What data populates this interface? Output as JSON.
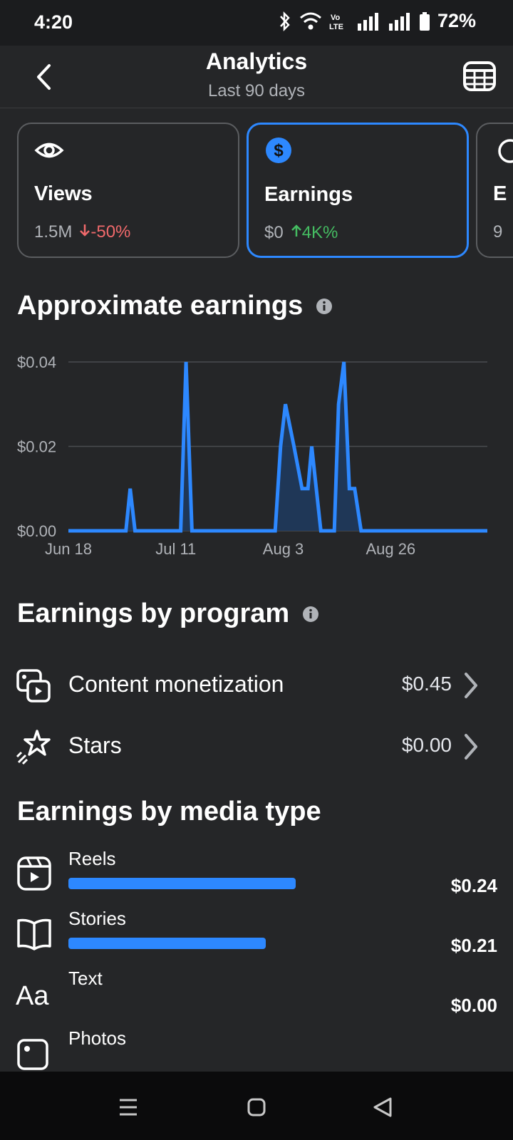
{
  "status_bar": {
    "time": "4:20",
    "battery": "72%"
  },
  "header": {
    "title": "Analytics",
    "subtitle": "Last 90 days"
  },
  "cards": [
    {
      "label": "Views",
      "value": "1.5M",
      "change": "-50%",
      "direction": "down",
      "icon": "eye-icon"
    },
    {
      "label": "Earnings",
      "value": "$0",
      "change": "4K%",
      "direction": "up",
      "icon": "dollar-icon"
    },
    {
      "label": "E",
      "value": "9",
      "change": "",
      "direction": "",
      "icon": "engagement-icon"
    }
  ],
  "approx_section": {
    "title": "Approximate earnings"
  },
  "chart_data": {
    "type": "area",
    "y_ticks": [
      "$0.04",
      "$0.02",
      "$0.00"
    ],
    "x_ticks": [
      "Jun 18",
      "Jul 11",
      "Aug 3",
      "Aug 26"
    ],
    "ylim": [
      0,
      0.04
    ],
    "xlim": [
      0,
      78
    ],
    "x_tick_positions": [
      0,
      20,
      40,
      60
    ],
    "series": [
      {
        "x": [
          0,
          10.7,
          11.5,
          12.4,
          20.9,
          21.9,
          23,
          38.5,
          39.5,
          40.4,
          42,
          43.5,
          44.6,
          45.3,
          47,
          49.5,
          50.3,
          51.3,
          52.3,
          53.3,
          54.5,
          78
        ],
        "y": [
          0,
          0,
          0.01,
          0,
          0,
          0.04,
          0,
          0,
          0.02,
          0.03,
          0.02,
          0.01,
          0.01,
          0.02,
          0,
          0,
          0.03,
          0.04,
          0.01,
          0.01,
          0,
          0
        ]
      }
    ],
    "color": "#2d88ff",
    "grid": true
  },
  "program_section": {
    "title": "Earnings by program",
    "items": [
      {
        "label": "Content monetization",
        "value": "$0.45"
      },
      {
        "label": "Stars",
        "value": "$0.00"
      }
    ]
  },
  "media_section": {
    "title": "Earnings by media type",
    "items": [
      {
        "label": "Reels",
        "value": "$0.24",
        "fraction": 0.54
      },
      {
        "label": "Stories",
        "value": "$0.21",
        "fraction": 0.47
      },
      {
        "label": "Text",
        "value": "$0.00",
        "fraction": 0
      },
      {
        "label": "Photos",
        "value": "",
        "fraction": 0
      }
    ]
  },
  "colors": {
    "accent": "#2d88ff",
    "down": "#f0696b",
    "up": "#45bd62",
    "background": "#252628"
  }
}
